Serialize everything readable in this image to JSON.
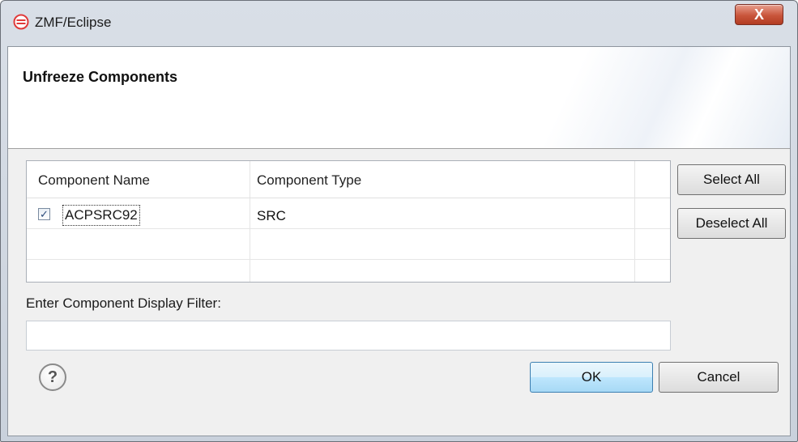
{
  "window": {
    "title": "ZMF/Eclipse",
    "close_label": "X",
    "app_icon": "zmf-logo-icon",
    "accent_color": "#e03a3a"
  },
  "banner": {
    "title": "Unfreeze Components"
  },
  "table": {
    "columns": [
      "Component Name",
      "Component Type"
    ],
    "rows": [
      {
        "checked": true,
        "name": "ACPSRC92",
        "type": "SRC"
      }
    ]
  },
  "side_buttons": {
    "select_all": "Select All",
    "deselect_all": "Deselect All"
  },
  "filter": {
    "label": "Enter Component Display Filter:",
    "value": ""
  },
  "footer": {
    "help_icon": "help-icon",
    "help_glyph": "?",
    "ok_label": "OK",
    "cancel_label": "Cancel"
  }
}
